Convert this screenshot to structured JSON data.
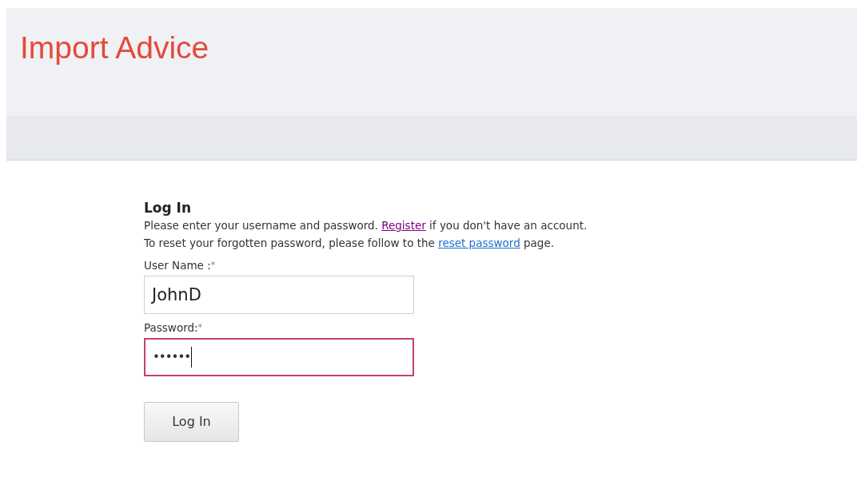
{
  "header": {
    "title": "Import Advice"
  },
  "login": {
    "heading": "Log In",
    "lines": [
      {
        "before": "Please enter your username and password. ",
        "link": "Register",
        "link_visited": true,
        "after": " if you don't have an account."
      },
      {
        "before": "To reset your forgotten password, please follow to the ",
        "link": "reset password",
        "link_visited": false,
        "after": " page."
      }
    ],
    "fields": [
      {
        "label": "User Name :",
        "required_mark": "*",
        "value": "JohnD",
        "kind": "text",
        "focused": false
      },
      {
        "label": "Password:",
        "required_mark": "*",
        "value": "••••••",
        "kind": "password",
        "focused": true
      }
    ],
    "button": "Log In"
  }
}
